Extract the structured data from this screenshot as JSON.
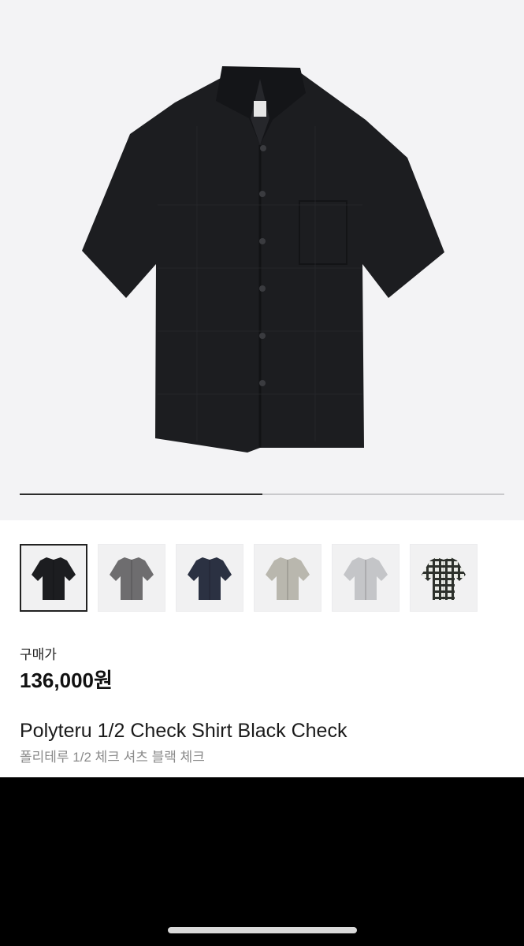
{
  "product": {
    "gallery": {
      "progress_fraction": 0.5,
      "total_images": 2
    },
    "color_options": [
      {
        "name": "black-check",
        "color": "#1c1d20",
        "pattern": "solid",
        "selected": true
      },
      {
        "name": "gray",
        "color": "#6e6d6f",
        "pattern": "solid",
        "selected": false
      },
      {
        "name": "navy",
        "color": "#2b3142",
        "pattern": "solid",
        "selected": false
      },
      {
        "name": "beige",
        "color": "#b9b7ae",
        "pattern": "solid",
        "selected": false
      },
      {
        "name": "light-gray",
        "color": "#c4c5c8",
        "pattern": "solid",
        "selected": false
      },
      {
        "name": "check",
        "color": "#e9ebe6",
        "pattern": "plaid",
        "selected": false
      }
    ],
    "price_label": "구매가",
    "price": "136,000원",
    "title_en": "Polyteru 1/2 Check Shirt Black Check",
    "title_ko": "폴리테루 1/2 체크 셔츠 블랙 체크"
  },
  "colors": {
    "hero_bg": "#f3f3f5",
    "shirt": "#1c1d20",
    "accent": "#111111"
  }
}
